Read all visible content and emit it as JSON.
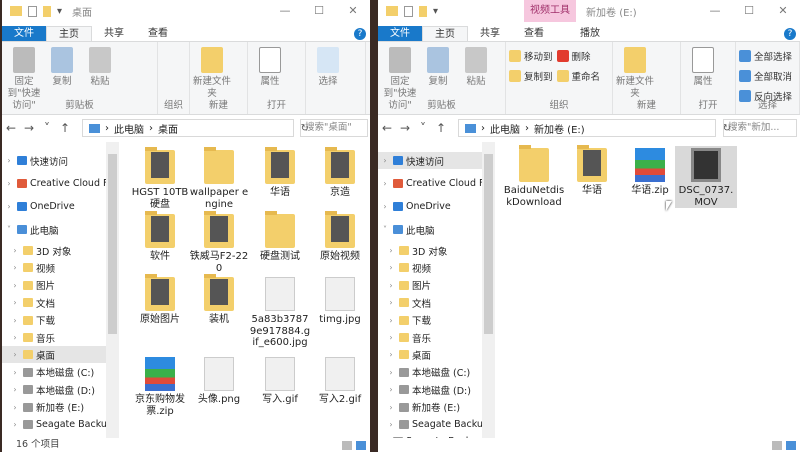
{
  "windows": [
    {
      "id": "desktop-window",
      "title": "桌面",
      "context_tab": null,
      "tabs": [
        "文件",
        "主页",
        "共享",
        "查看"
      ],
      "extra_tab": null,
      "ribbon": [
        {
          "label": "剪贴板",
          "bigs": [
            "固定到\"快速访问\"",
            "复制",
            "粘贴"
          ],
          "smalls": []
        },
        {
          "label": "组织",
          "bigs": [],
          "smalls": []
        },
        {
          "label": "新建",
          "bigs": [
            "新建文件夹"
          ],
          "smalls": []
        },
        {
          "label": "打开",
          "bigs": [
            "属性"
          ],
          "smalls": []
        },
        {
          "label": "",
          "bigs": [
            "选择"
          ],
          "smalls": []
        }
      ],
      "path": [
        "此电脑",
        "桌面"
      ],
      "search_placeholder": "搜索\"桌面\"",
      "nav": [
        {
          "label": "快速访问",
          "level": 0,
          "icon": "star"
        },
        {
          "label": "Creative Cloud F",
          "level": 0,
          "icon": "cc"
        },
        {
          "label": "OneDrive",
          "level": 0,
          "icon": "cloud"
        },
        {
          "label": "此电脑",
          "level": 0,
          "icon": "pc",
          "expanded": true
        },
        {
          "label": "3D 对象",
          "level": 1,
          "icon": "folder"
        },
        {
          "label": "视频",
          "level": 1,
          "icon": "folder"
        },
        {
          "label": "图片",
          "level": 1,
          "icon": "folder"
        },
        {
          "label": "文档",
          "level": 1,
          "icon": "folder"
        },
        {
          "label": "下载",
          "level": 1,
          "icon": "folder"
        },
        {
          "label": "音乐",
          "level": 1,
          "icon": "folder"
        },
        {
          "label": "桌面",
          "level": 1,
          "icon": "folder",
          "selected": true
        },
        {
          "label": "本地磁盘 (C:)",
          "level": 1,
          "icon": "drive"
        },
        {
          "label": "本地磁盘 (D:)",
          "level": 1,
          "icon": "drive"
        },
        {
          "label": "新加卷 (E:)",
          "level": 1,
          "icon": "drive"
        },
        {
          "label": "Seagate Backup",
          "level": 1,
          "icon": "drive"
        }
      ],
      "items": [
        {
          "name": "HGST 10TB硬盘",
          "type": "folder-thumb"
        },
        {
          "name": "wallpaper engine",
          "type": "folder"
        },
        {
          "name": "华语",
          "type": "folder-thumb"
        },
        {
          "name": "京造",
          "type": "folder-thumb"
        },
        {
          "name": "软件",
          "type": "folder-thumb"
        },
        {
          "name": "铁威马F2-220",
          "type": "folder-thumb"
        },
        {
          "name": "硬盘测试",
          "type": "folder"
        },
        {
          "name": "原始视频",
          "type": "folder-thumb"
        },
        {
          "name": "原始图片",
          "type": "folder-thumb"
        },
        {
          "name": "装机",
          "type": "folder-thumb"
        },
        {
          "name": "5a83b37879e917884.gif_e600.jpg",
          "type": "image"
        },
        {
          "name": "timg.jpg",
          "type": "image"
        },
        {
          "name": "京东购物发票.zip",
          "type": "zip"
        },
        {
          "name": "头像.png",
          "type": "image"
        },
        {
          "name": "写入.gif",
          "type": "image"
        },
        {
          "name": "写入2.gif",
          "type": "image"
        }
      ],
      "status": "16 个项目"
    },
    {
      "id": "drive-e-window",
      "title": "新加卷 (E:)",
      "context_tab": "视频工具",
      "tabs": [
        "文件",
        "主页",
        "共享",
        "查看"
      ],
      "extra_tab": "播放",
      "ribbon": [
        {
          "label": "剪贴板",
          "bigs": [
            "固定到\"快速访问\"",
            "复制",
            "粘贴"
          ],
          "smalls": []
        },
        {
          "label": "组织",
          "bigs": [],
          "smalls": [
            "移动到",
            "复制到"
          ],
          "smalls2": [
            "删除",
            "重命名"
          ]
        },
        {
          "label": "新建",
          "bigs": [
            "新建文件夹"
          ],
          "smalls": []
        },
        {
          "label": "打开",
          "bigs": [
            "属性"
          ],
          "smalls": []
        },
        {
          "label": "选择",
          "bigs": [],
          "smalls": [
            "全部选择",
            "全部取消",
            "反向选择"
          ]
        }
      ],
      "path": [
        "此电脑",
        "新加卷 (E:)"
      ],
      "search_placeholder": "搜索\"新加...",
      "nav": [
        {
          "label": "快速访问",
          "level": 0,
          "icon": "star",
          "selected": true
        },
        {
          "label": "Creative Cloud F",
          "level": 0,
          "icon": "cc"
        },
        {
          "label": "OneDrive",
          "level": 0,
          "icon": "cloud"
        },
        {
          "label": "此电脑",
          "level": 0,
          "icon": "pc",
          "expanded": true
        },
        {
          "label": "3D 对象",
          "level": 1,
          "icon": "folder"
        },
        {
          "label": "视频",
          "level": 1,
          "icon": "folder"
        },
        {
          "label": "图片",
          "level": 1,
          "icon": "folder"
        },
        {
          "label": "文档",
          "level": 1,
          "icon": "folder"
        },
        {
          "label": "下载",
          "level": 1,
          "icon": "folder"
        },
        {
          "label": "音乐",
          "level": 1,
          "icon": "folder"
        },
        {
          "label": "桌面",
          "level": 1,
          "icon": "folder"
        },
        {
          "label": "本地磁盘 (C:)",
          "level": 1,
          "icon": "drive"
        },
        {
          "label": "本地磁盘 (D:)",
          "level": 1,
          "icon": "drive"
        },
        {
          "label": "新加卷 (E:)",
          "level": 1,
          "icon": "drive"
        },
        {
          "label": "Seagate Backup",
          "level": 1,
          "icon": "drive"
        },
        {
          "label": "Seagate Backup",
          "level": 0,
          "icon": "drive"
        }
      ],
      "items": [
        {
          "name": "BaiduNetdiskDownload",
          "type": "folder"
        },
        {
          "name": "华语",
          "type": "folder-thumb"
        },
        {
          "name": "华语.zip",
          "type": "zip"
        },
        {
          "name": "DSC_0737.MOV",
          "type": "video",
          "selected": true
        }
      ],
      "status": ""
    }
  ],
  "colors": {
    "file_tab": "#1979ca",
    "context_tab": "#f6c7de",
    "folder": "#f3cf6b"
  }
}
